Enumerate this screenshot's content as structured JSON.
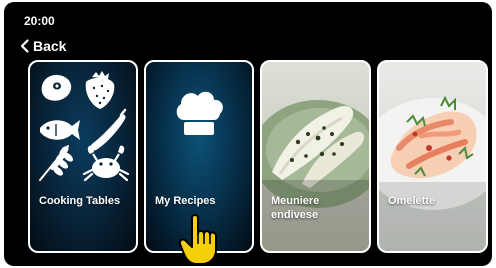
{
  "status_bar": {
    "time": "20:00"
  },
  "nav": {
    "back_label": "Back"
  },
  "cards": [
    {
      "label": "Cooking Tables"
    },
    {
      "label": "My Recipes"
    },
    {
      "label": "Meuniere\nendivese"
    },
    {
      "label": "Omelette"
    }
  ],
  "colors": {
    "background": "#000000",
    "card_border": "#ffffff",
    "hand_pointer": "#f4d00a"
  }
}
